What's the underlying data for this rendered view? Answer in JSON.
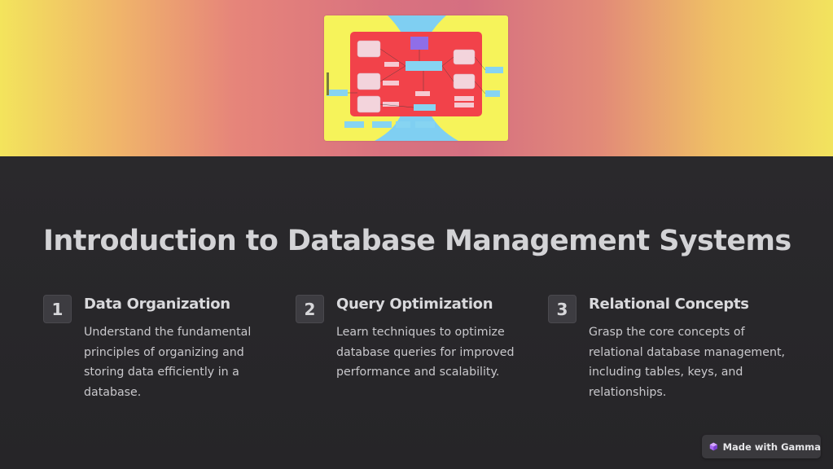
{
  "slide": {
    "title": "Introduction to Database Management Systems",
    "steps": [
      {
        "number": "1",
        "title": "Data Organization",
        "description": "Understand the fundamental principles of organizing and storing data efficiently in a database."
      },
      {
        "number": "2",
        "title": "Query Optimization",
        "description": "Learn techniques to optimize database queries for improved performance and scalability."
      },
      {
        "number": "3",
        "title": "Relational Concepts",
        "description": "Grasp the core concepts of relational database management, including tables, keys, and relationships."
      }
    ]
  },
  "badge": {
    "label": "Made with Gamma",
    "icon": "gamma-logo-icon"
  },
  "colors": {
    "background": "#272629",
    "hero_yellow": "#f3e45c",
    "hero_pink": "#d9727f",
    "diagram_red": "#f2424a",
    "diagram_yellow": "#f6f35a",
    "diagram_blue": "#7fd0f0"
  }
}
